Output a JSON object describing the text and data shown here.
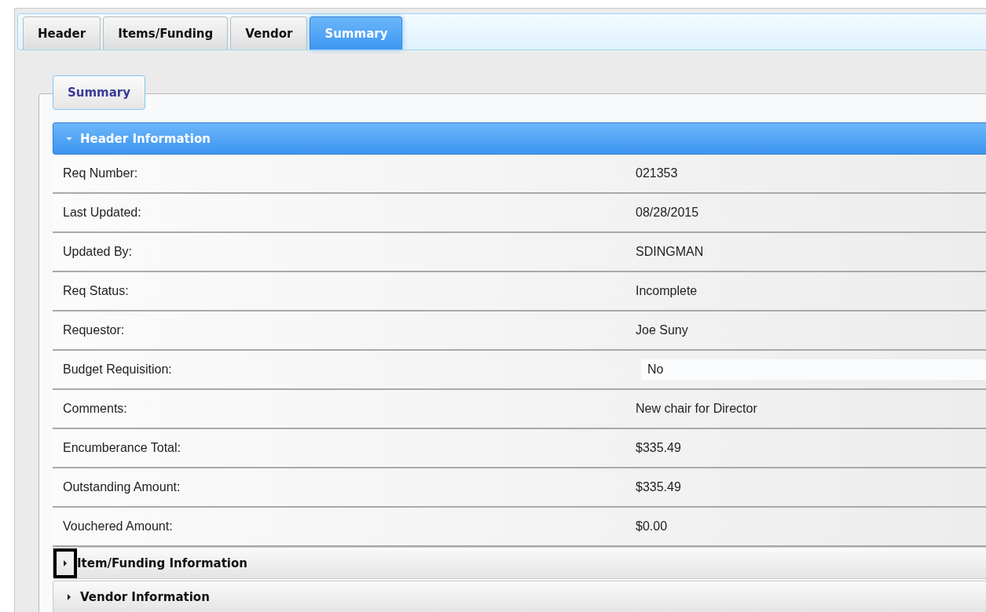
{
  "tabs": [
    {
      "label": "Header",
      "selected": false
    },
    {
      "label": "Items/Funding",
      "selected": false
    },
    {
      "label": "Vendor",
      "selected": false
    },
    {
      "label": "Summary",
      "selected": true
    }
  ],
  "panel": {
    "legend": "Summary"
  },
  "sections": [
    {
      "title": "Header Information",
      "expanded": true,
      "highlighted": false,
      "rows": [
        {
          "label": "Req Number:",
          "value": "021353"
        },
        {
          "label": "Last Updated:",
          "value": "08/28/2015"
        },
        {
          "label": "Updated By:",
          "value": "SDINGMAN"
        },
        {
          "label": "Req Status:",
          "value": "Incomplete"
        },
        {
          "label": "Requestor:",
          "value": "Joe Suny"
        },
        {
          "label": "Budget Requisition:",
          "value": "No",
          "kind": "select"
        },
        {
          "label": "Comments:",
          "value": "New chair for Director"
        },
        {
          "label": "Encumberance Total:",
          "value": "$335.49"
        },
        {
          "label": "Outstanding Amount:",
          "value": "$335.49"
        },
        {
          "label": "Vouchered Amount:",
          "value": "$0.00"
        }
      ]
    },
    {
      "title": "Item/Funding Information",
      "expanded": false,
      "highlighted": true
    },
    {
      "title": "Vendor Information",
      "expanded": false,
      "highlighted": false
    }
  ]
}
